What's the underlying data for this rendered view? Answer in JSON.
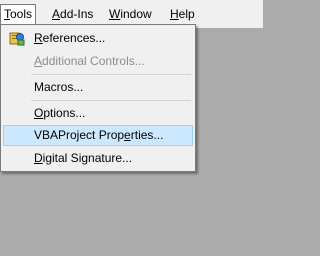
{
  "menubar": {
    "items": [
      {
        "pre": "",
        "key": "T",
        "post": "ools"
      },
      {
        "pre": "",
        "key": "A",
        "post": "dd-Ins"
      },
      {
        "pre": "",
        "key": "W",
        "post": "indow"
      },
      {
        "pre": "",
        "key": "H",
        "post": "elp"
      }
    ]
  },
  "tools_menu": {
    "items": [
      {
        "pre": "",
        "key": "R",
        "post": "eferences...",
        "icon": "references-icon"
      },
      {
        "pre": "",
        "key": "A",
        "post": "dditional Controls...",
        "disabled": true
      },
      {
        "pre": "Macros",
        "key": "",
        "post": "..."
      },
      {
        "pre": "",
        "key": "O",
        "post": "ptions..."
      },
      {
        "pre": "VBAProject Prop",
        "key": "e",
        "post": "rties...",
        "highlighted": true
      },
      {
        "pre": "",
        "key": "D",
        "post": "igital Signature..."
      }
    ]
  },
  "colors": {
    "highlight_bg": "#cce8ff",
    "highlight_border": "#99d1ff",
    "disabled_text": "#8d8d8d",
    "menu_bg": "#f0f0f0",
    "workspace_bg": "#ababab"
  }
}
